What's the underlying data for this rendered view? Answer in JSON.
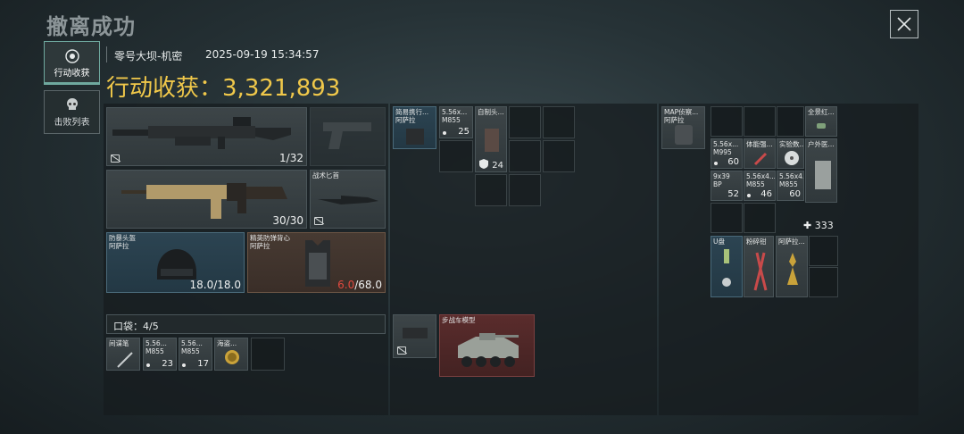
{
  "header": {
    "title": "撤离成功",
    "map": "零号大坝-机密",
    "datetime": "2025-09-19 15:34:57",
    "haul_label": "行动收获：",
    "haul_value": "3,321,893"
  },
  "tabs": [
    {
      "label": "行动收获"
    },
    {
      "label": "击败列表"
    }
  ],
  "gear": {
    "primary": {
      "ammo": "1/32"
    },
    "secondary": {
      "ammo": "30/30"
    },
    "knife": {
      "label": "战术匕首"
    },
    "helmet": {
      "label": "防暴头盔",
      "sub": "阿萨拉",
      "durability": "18.0/18.0"
    },
    "armor": {
      "label": "精英防弹背心",
      "sub": "阿萨拉",
      "durability_current": "6.0",
      "durability_max": "/68.0"
    }
  },
  "pocket": {
    "label": "口袋：4/5",
    "items": [
      {
        "label": "间谍笔"
      },
      {
        "label": "5.56...",
        "sub": "M855",
        "count": "23"
      },
      {
        "label": "5.56...",
        "sub": "M855",
        "count": "17"
      },
      {
        "label": "海盗..."
      }
    ]
  },
  "chest": {
    "items": [
      {
        "label": "简易携行...",
        "sub": "阿萨拉"
      },
      {
        "label": "5.56x...",
        "sub": "M855",
        "count": "25"
      },
      {
        "label": "自制头...",
        "count": "24"
      }
    ]
  },
  "backpack_mid": {
    "items": [
      {
        "label": "步战车模型"
      }
    ]
  },
  "backpack": {
    "items": [
      {
        "label": "MAP侦察...",
        "sub": "阿萨拉"
      },
      {
        "label": "全景红..."
      },
      {
        "label": "5.56x...",
        "sub": "M995",
        "count": "60"
      },
      {
        "label": "体能强..."
      },
      {
        "label": "实验数..."
      },
      {
        "label": "户外医..."
      },
      {
        "label": "9x39",
        "sub": "BP",
        "count": "52"
      },
      {
        "label": "5.56x4...",
        "sub": "M855",
        "count": "46"
      },
      {
        "label": "5.56x4...",
        "sub": "M855",
        "count": "60"
      }
    ],
    "capacity": "333",
    "extra": [
      {
        "label": "U盘"
      },
      {
        "label": "粉碎钳"
      },
      {
        "label": "阿萨拉..."
      }
    ]
  },
  "colors": {
    "gold": "#f0c84a",
    "red": "#e0493f",
    "teal": "#6fa99f"
  }
}
